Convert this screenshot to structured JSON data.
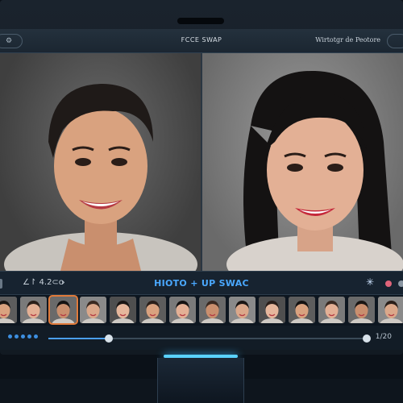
{
  "window": {
    "title": "FCCE SWAP",
    "right_label": "Wirtotgr de Peotore"
  },
  "toolbar": {
    "left_label": "∠↾ 4.2⊂o",
    "chevron": "›",
    "mode_label": "HIOTO  + UP SWAC"
  },
  "thumbnails": {
    "count": 15,
    "selected_index": 2
  },
  "timeline": {
    "progress": 0.19,
    "time_label": "1/20"
  },
  "colors": {
    "accent_blue": "#4aa8ff",
    "stand_glow": "#5ad2ff",
    "selected_thumb_border": "#e07a3a",
    "record_dot": "#e0647a"
  },
  "icons": {
    "left_menu": "settings-icon",
    "chevron": "chevron-right-icon",
    "sparkle": "sparkle-icon",
    "record": "record-dot-icon"
  }
}
